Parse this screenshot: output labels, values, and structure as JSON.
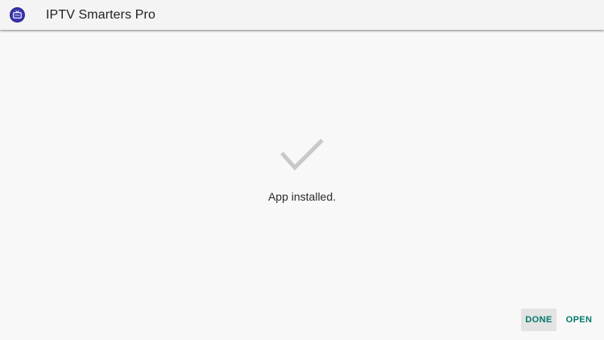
{
  "app_bar": {
    "title": "IPTV Smarters Pro",
    "icon": "iptv-tv-icon"
  },
  "main": {
    "status_icon": "checkmark-icon",
    "status_text": "App installed."
  },
  "actions": {
    "done_label": "DONE",
    "open_label": "OPEN"
  },
  "colors": {
    "accent": "#00796b",
    "app_icon_bg": "#2e2a8f",
    "check_color": "#c8c8c8",
    "background": "#f8f8f8"
  }
}
